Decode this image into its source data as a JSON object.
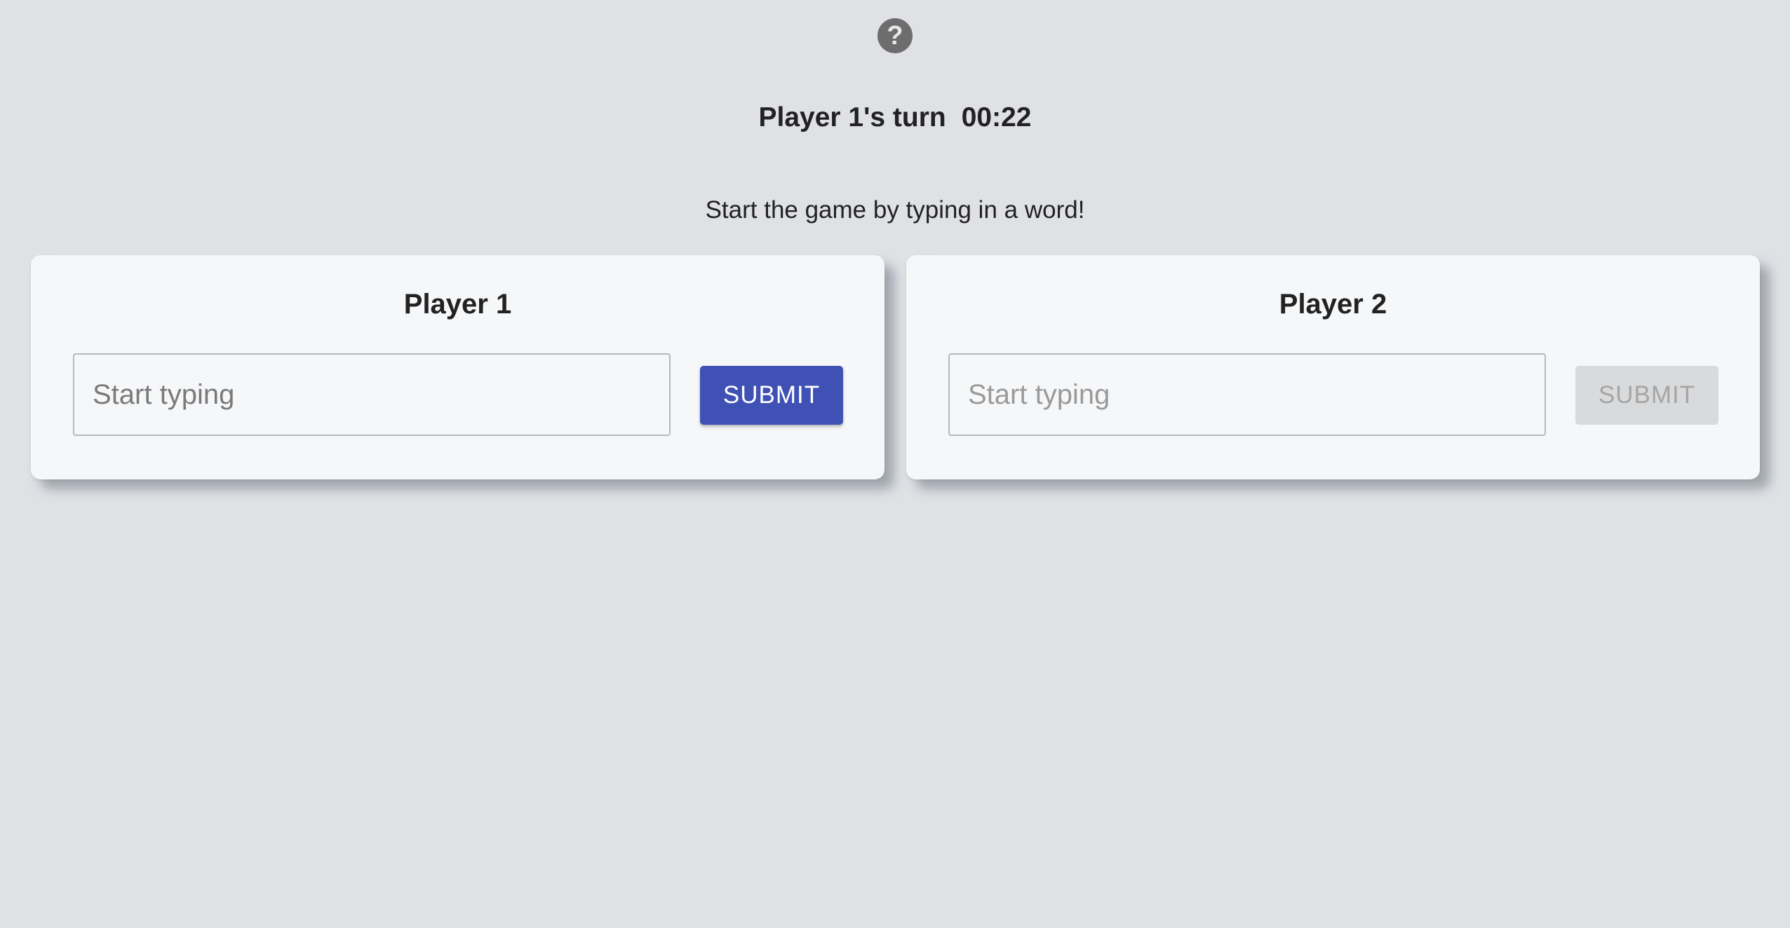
{
  "help": {
    "icon": "help-circle-icon",
    "glyph": "?"
  },
  "status": {
    "turn_text": "Player 1's turn",
    "timer": "00:22"
  },
  "hint": "Start the game by typing in a word!",
  "players": [
    {
      "title": "Player 1",
      "input_placeholder": "Start typing",
      "input_value": "",
      "submit_label": "SUBMIT",
      "submit_enabled": true
    },
    {
      "title": "Player 2",
      "input_placeholder": "Start typing",
      "input_value": "",
      "submit_label": "SUBMIT",
      "submit_enabled": false
    }
  ],
  "colors": {
    "background": "#dfe1e5",
    "card": "#f6f7f9",
    "accent": "#3f51b5",
    "disabled_button": "#d9dadc"
  }
}
